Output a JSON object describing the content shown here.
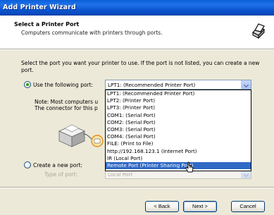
{
  "window": {
    "title": "Add Printer Wizard"
  },
  "header": {
    "title": "Select a Printer Port",
    "subtitle": "Computers communicate with printers through ports."
  },
  "intro": "Select the port you want your printer to use.  If the port is not listed, you can create a new port.",
  "use_port": {
    "label": "Use the following port:",
    "selected_value": "LPT1: (Recommended Printer Port)",
    "options": [
      "LPT1: (Recommended Printer Port)",
      "LPT2: (Printer Port)",
      "LPT3: (Printer Port)",
      "COM1: (Serial Port)",
      "COM2: (Serial Port)",
      "COM3: (Serial Port)",
      "COM4: (Serial Port)",
      "FILE: (Print to File)",
      "http://192.168.123.1 (Internet Port)",
      "IR (Local Port)",
      "Remote Port (Printer Sharing Port)"
    ],
    "highlighted_index": 10
  },
  "note": {
    "line1": "Note: Most computers u",
    "line2": "The connector for this p"
  },
  "create_port": {
    "label": "Create a new port:",
    "type_label": "Type of port:",
    "type_value": "Local Port"
  },
  "buttons": {
    "back": "< Back",
    "next": "Next >",
    "cancel": "Cancel"
  },
  "icons": {
    "header": "printer-icon",
    "illustration": "printer-port-icon",
    "cursor": "mouse-cursor-icon"
  },
  "colors": {
    "titlebar": "#0a5fd8",
    "selection": "#316ac5",
    "dialog_bg": "#ece9d8"
  }
}
